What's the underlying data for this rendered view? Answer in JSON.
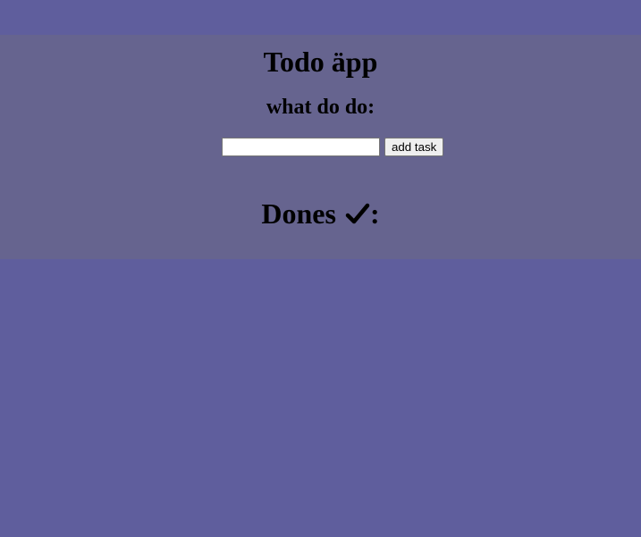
{
  "app": {
    "title": "Todo äpp",
    "prompt": "what do do:"
  },
  "form": {
    "input_value": "",
    "input_placeholder": "",
    "add_button_label": "add task"
  },
  "dones": {
    "label": "Dones",
    "icon": "check-icon",
    "suffix": ":"
  },
  "colors": {
    "page_background": "#5f5e9d",
    "panel_background": "#66648f",
    "text": "#000000"
  }
}
